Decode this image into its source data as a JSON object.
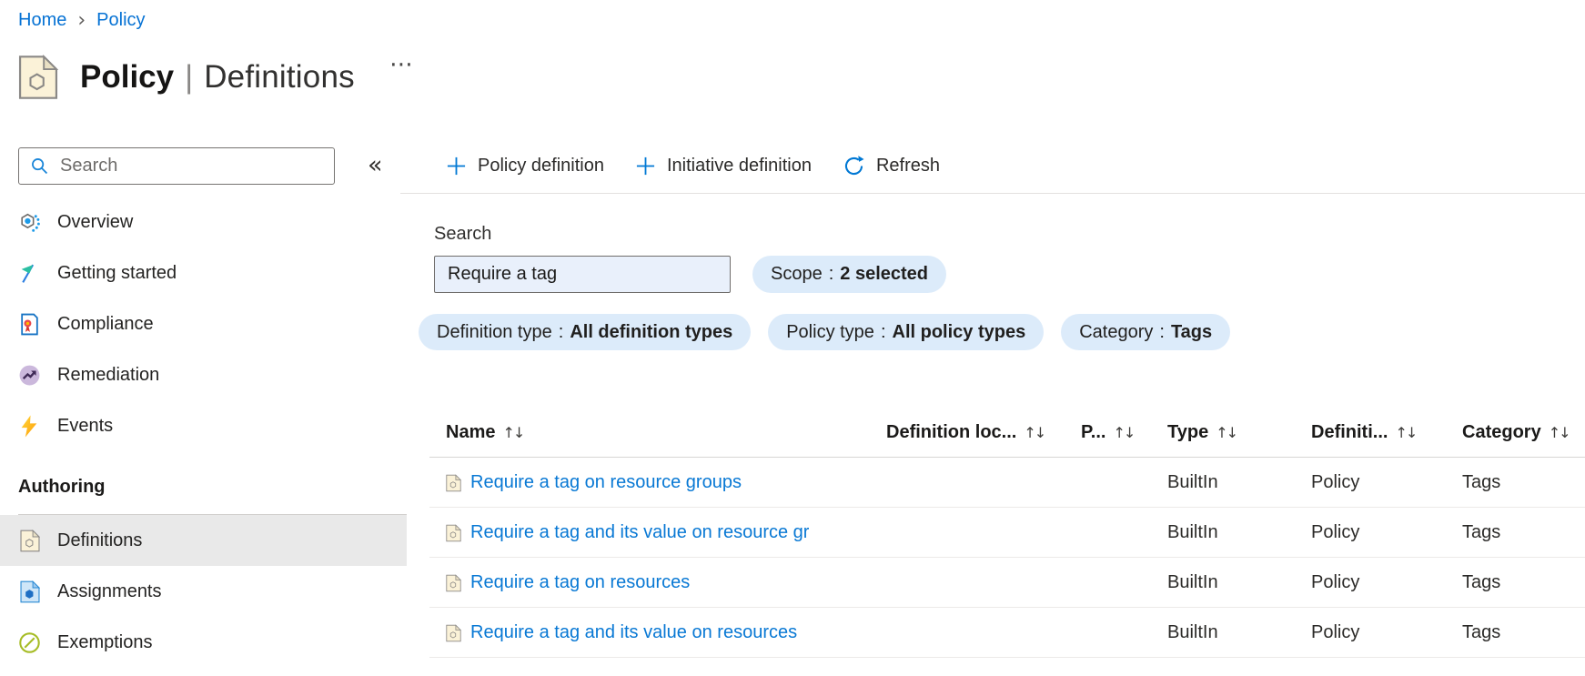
{
  "breadcrumb": {
    "separator": "›",
    "items": [
      {
        "label": "Home"
      },
      {
        "label": "Policy"
      }
    ]
  },
  "header": {
    "title": "Policy",
    "separator": "|",
    "subtitle": "Definitions",
    "more_glyph": "⋯"
  },
  "sidebar": {
    "search_placeholder": "Search",
    "collapse_glyph": "«",
    "items": [
      {
        "label": "Overview",
        "icon": "overview-icon"
      },
      {
        "label": "Getting started",
        "icon": "getting-started-icon"
      },
      {
        "label": "Compliance",
        "icon": "compliance-icon"
      },
      {
        "label": "Remediation",
        "icon": "remediation-icon"
      },
      {
        "label": "Events",
        "icon": "events-icon"
      }
    ],
    "section_label": "Authoring",
    "authoring_items": [
      {
        "label": "Definitions",
        "icon": "definitions-icon",
        "selected": true
      },
      {
        "label": "Assignments",
        "icon": "assignments-icon",
        "selected": false
      },
      {
        "label": "Exemptions",
        "icon": "exemptions-icon",
        "selected": false
      }
    ]
  },
  "toolbar": {
    "buttons": [
      {
        "label": "Policy definition",
        "icon": "plus-icon"
      },
      {
        "label": "Initiative definition",
        "icon": "plus-icon"
      },
      {
        "label": "Refresh",
        "icon": "refresh-icon"
      }
    ]
  },
  "filters": {
    "search_label": "Search",
    "search_value": "Require a tag",
    "pill_separator": ":",
    "pills": [
      {
        "name": "Scope",
        "value": "2 selected"
      },
      {
        "name": "Definition type",
        "value": "All definition types"
      },
      {
        "name": "Policy type",
        "value": "All policy types"
      },
      {
        "name": "Category",
        "value": "Tags"
      }
    ]
  },
  "table": {
    "sort_glyph": "↑↓",
    "columns": [
      {
        "label": "Name"
      },
      {
        "label": "Definition loc..."
      },
      {
        "label": "P..."
      },
      {
        "label": "Type"
      },
      {
        "label": "Definiti..."
      },
      {
        "label": "Category"
      }
    ],
    "rows": [
      {
        "name": "Require a tag on resource groups",
        "definition_location": "",
        "p": "",
        "type": "BuiltIn",
        "definition_type": "Policy",
        "category": "Tags"
      },
      {
        "name": "Require a tag and its value on resource gr",
        "definition_location": "",
        "p": "",
        "type": "BuiltIn",
        "definition_type": "Policy",
        "category": "Tags"
      },
      {
        "name": "Require a tag on resources",
        "definition_location": "",
        "p": "",
        "type": "BuiltIn",
        "definition_type": "Policy",
        "category": "Tags"
      },
      {
        "name": "Require a tag and its value on resources",
        "definition_location": "",
        "p": "",
        "type": "BuiltIn",
        "definition_type": "Policy",
        "category": "Tags"
      }
    ]
  },
  "colors": {
    "accent": "#0078d4",
    "link": "#0878d4",
    "pill_background": "#dcebfa",
    "selected_item_background": "#e9e9e9",
    "policy_icon_fill": "#fbf2d8"
  }
}
